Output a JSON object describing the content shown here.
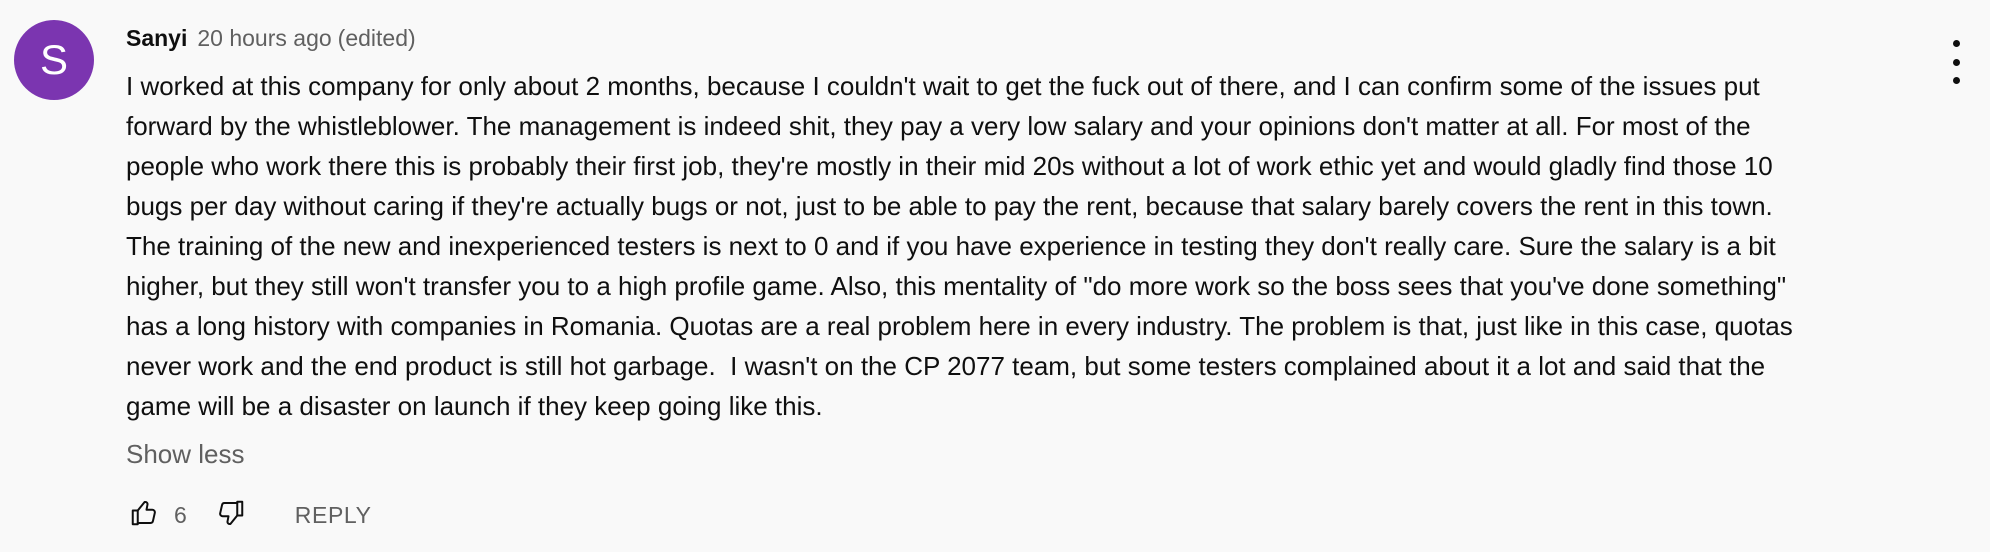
{
  "comment": {
    "avatar_initial": "S",
    "avatar_color": "#7b35b0",
    "author": "Sanyi",
    "time": "20 hours ago",
    "edited": "(edited)",
    "text": "I worked at this company for only about 2 months, because I couldn't wait to get the fuck out of there, and I can confirm some of the issues put\nforward by the whistleblower. The management is indeed shit, they pay a very low salary and your opinions don't matter at all. For most of the\npeople who work there this is probably their first job, they're mostly in their mid 20s without a lot of work ethic yet and would gladly find those 10\nbugs per day without caring if they're actually bugs or not, just to be able to pay the rent, because that salary barely covers the rent in this town.\nThe training of the new and inexperienced testers is next to 0 and if you have experience in testing they don't really care. Sure the salary is a bit\nhigher, but they still won't transfer you to a high profile game. Also, this mentality of \"do more work so the boss sees that you've done something\"\nhas a long history with companies in Romania. Quotas are a real problem here in every industry. The problem is that, just like in this case, quotas\nnever work and the end product is still hot garbage.  I wasn't on the CP 2077 team, but some testers complained about it a lot and said that the\ngame will be a disaster on launch if they keep going like this.",
    "show_less_label": "Show less",
    "like_count": "6",
    "reply_label": "REPLY"
  },
  "icons": {
    "like": "thumbs-up-icon",
    "dislike": "thumbs-down-icon",
    "menu": "more-vertical-icon"
  }
}
